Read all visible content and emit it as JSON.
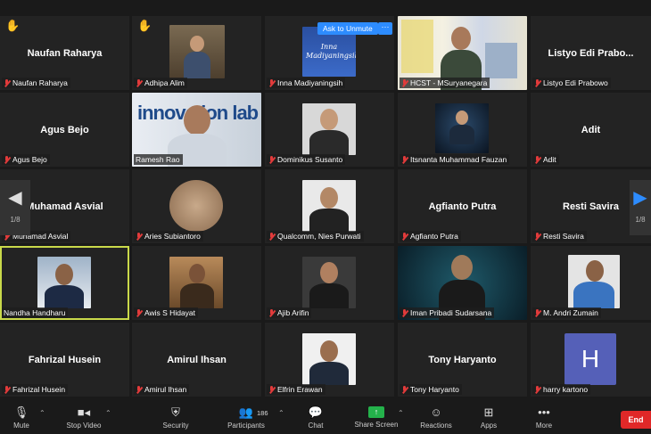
{
  "meeting": {
    "ask_to_unmute": "Ask to Unmute",
    "more_dots": "···",
    "page_left": "1/8",
    "page_right": "1/8"
  },
  "participants": [
    {
      "label": "Naufan Raharya",
      "display": "Naufan Raharya",
      "video": false,
      "hand": true
    },
    {
      "label": "Adhipa Alim",
      "display": "",
      "video": true,
      "hand": true
    },
    {
      "label": "Inna Madiyaningsih",
      "display": "",
      "video": true,
      "hand": false,
      "photo_text": "Inna Madiyaningsih"
    },
    {
      "label": "HCST - MSuryanegara",
      "display": "",
      "video": true,
      "hand": false
    },
    {
      "label": "Listyo Edi Prabowo",
      "display": "Listyo Edi Prabo...",
      "video": false,
      "hand": false
    },
    {
      "label": "Agus Bejo",
      "display": "Agus Bejo",
      "video": false,
      "hand": false
    },
    {
      "label": "Ramesh Rao",
      "display": "",
      "video": true,
      "hand": false,
      "photo_text": "innovation lab"
    },
    {
      "label": "Dominikus Susanto",
      "display": "",
      "video": true,
      "hand": false
    },
    {
      "label": "Itsnanta Muhammad Fauzan",
      "display": "",
      "video": true,
      "hand": false
    },
    {
      "label": "Adit",
      "display": "Adit",
      "video": false,
      "hand": false
    },
    {
      "label": "Muhamad Asvial",
      "display": "Muhamad Asvial",
      "video": false,
      "hand": false
    },
    {
      "label": "Aries Subiantoro",
      "display": "",
      "video": true,
      "hand": false
    },
    {
      "label": "Qualcomm, Nies Purwati",
      "display": "",
      "video": true,
      "hand": false
    },
    {
      "label": "Agfianto Putra",
      "display": "Agfianto Putra",
      "video": false,
      "hand": false
    },
    {
      "label": "Resti Savira",
      "display": "Resti Savira",
      "video": false,
      "hand": false
    },
    {
      "label": "Nandha Handharu",
      "display": "",
      "video": true,
      "hand": false,
      "speaking": true
    },
    {
      "label": "Awis S Hidayat",
      "display": "",
      "video": true,
      "hand": false
    },
    {
      "label": "Ajib Arifin",
      "display": "",
      "video": true,
      "hand": false
    },
    {
      "label": "Iman Pribadi Sudarsana",
      "display": "",
      "video": true,
      "hand": false
    },
    {
      "label": "M. Andri Zumain",
      "display": "",
      "video": true,
      "hand": false
    },
    {
      "label": "Fahrizal Husein",
      "display": "Fahrizal Husein",
      "video": false,
      "hand": false
    },
    {
      "label": "Amirul Ihsan",
      "display": "Amirul Ihsan",
      "video": false,
      "hand": false
    },
    {
      "label": "Elfrin Erawan",
      "display": "",
      "video": true,
      "hand": false
    },
    {
      "label": "Tony Haryanto",
      "display": "Tony Haryanto",
      "video": false,
      "hand": false
    },
    {
      "label": "harry kartono",
      "display": "",
      "video": false,
      "hand": false,
      "avatar_letter": "H"
    }
  ],
  "toolbar": {
    "mute": "Mute",
    "stop_video": "Stop Video",
    "security": "Security",
    "participants": "Participants",
    "participants_count": "186",
    "chat": "Chat",
    "share_screen": "Share Screen",
    "reactions": "Reactions",
    "apps": "Apps",
    "more": "More",
    "end": "End"
  },
  "icons": {
    "hand": "raised-hand-icon",
    "mic_off": "mic-muted-icon",
    "mute": "microphone-icon",
    "video": "video-camera-icon",
    "security": "shield-icon",
    "participants": "people-icon",
    "chat": "chat-bubble-icon",
    "share": "share-screen-icon",
    "reactions": "emoji-plus-icon",
    "apps": "apps-icon",
    "more": "ellipsis-icon"
  },
  "colors": {
    "background": "#1a1a1a",
    "tile": "#232323",
    "muted_red": "#e23b3b",
    "hand_yellow": "#f5c20a",
    "accent_blue": "#2d8cff",
    "share_green": "#24b24b",
    "end_red": "#e02828",
    "speaking_outline": "#c9d94a",
    "avatar_purple": "#5560b8"
  }
}
